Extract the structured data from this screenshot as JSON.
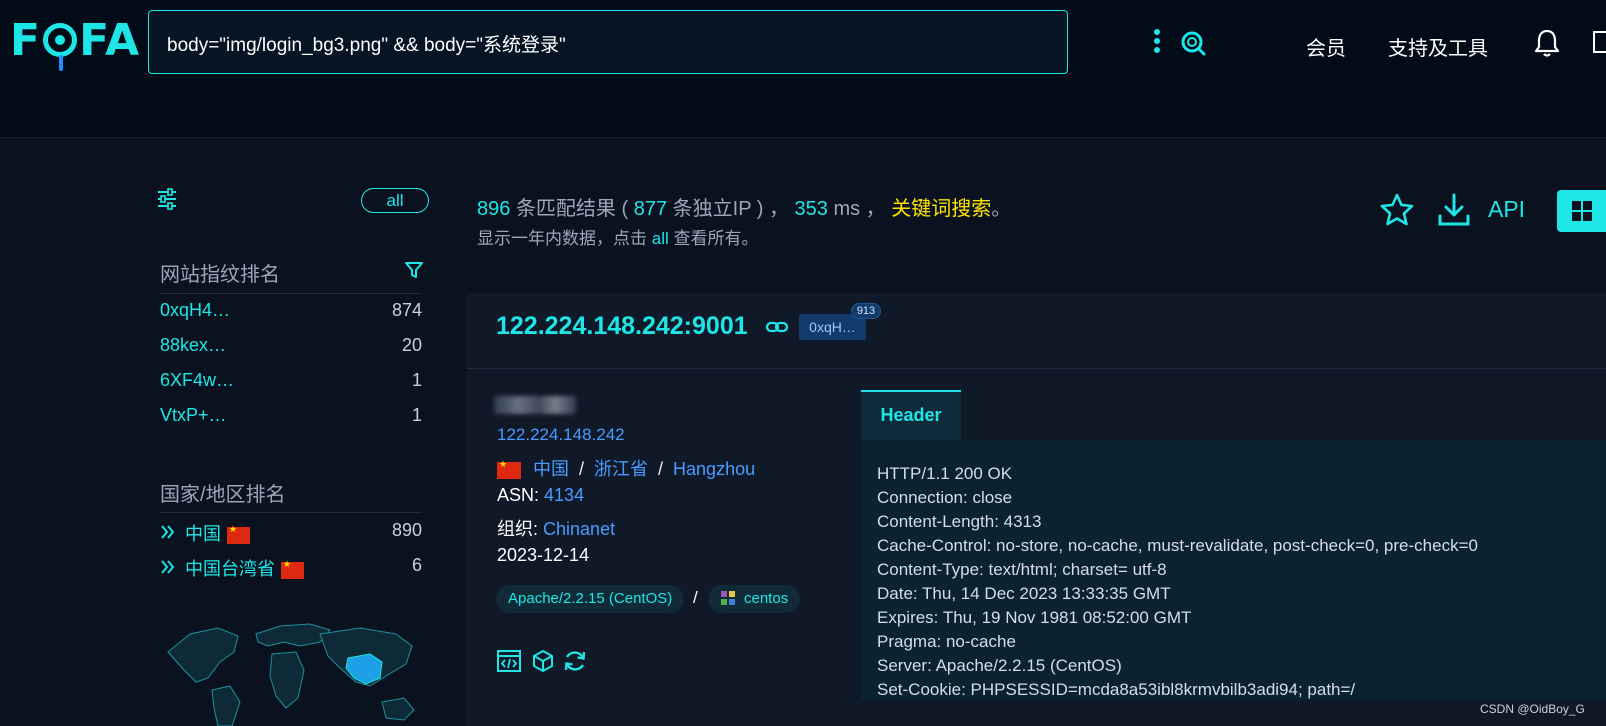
{
  "search": {
    "query": "body=\"img/login_bg3.png\" && body=\"系统登录\""
  },
  "logo": {
    "p1": "F",
    "p2": "FA"
  },
  "nav": {
    "member": "会员",
    "tools": "支持及工具"
  },
  "sidebar": {
    "all_label": "all",
    "fingerprint_title": "网站指纹排名",
    "fingerprints": [
      {
        "name": "0xqH4…",
        "count": "874"
      },
      {
        "name": "88kex…",
        "count": "20"
      },
      {
        "name": "6XF4w…",
        "count": "1"
      },
      {
        "name": "VtxP+…",
        "count": "1"
      }
    ],
    "country_title": "国家/地区排名",
    "countries": [
      {
        "name": "中国",
        "count": "890"
      },
      {
        "name": "中国台湾省",
        "count": "6"
      }
    ]
  },
  "summary": {
    "match_count": "896",
    "match_label": "条匹配结果 (",
    "ip_count": "877",
    "ip_label": "条独立IP ) ，",
    "ms": "353",
    "ms_label": "ms ，",
    "keyword": "关键词搜索",
    "end": "。",
    "note_pre": "显示一年内数据，点击",
    "note_all": "all",
    "note_post": "查看所有。"
  },
  "toolbar": {
    "api_label": "API"
  },
  "result": {
    "host": "122.224.148.242:9001",
    "tag": "0xqH…",
    "tag_count": "913",
    "ip": "122.224.148.242",
    "country": "中国",
    "province": "浙江省",
    "city": "Hangzhou",
    "sep": "/",
    "asn_label": "ASN:",
    "asn": "4134",
    "org_label": "组织:",
    "org": "Chinanet",
    "date": "2023-12-14",
    "server_chip": "Apache/2.2.15 (CentOS)",
    "os_chip": "centos",
    "tab_label": "Header",
    "header_lines": [
      "HTTP/1.1 200 OK",
      "Connection: close",
      "Content-Length: 4313",
      "Cache-Control: no-store, no-cache, must-revalidate, post-check=0, pre-check=0",
      "Content-Type: text/html; charset= utf-8",
      "Date: Thu, 14 Dec 2023 13:33:35 GMT",
      "Expires: Thu, 19 Nov 1981 08:52:00 GMT",
      "Pragma: no-cache",
      "Server: Apache/2.2.15 (CentOS)",
      "Set-Cookie: PHPSESSID=mcda8a53ibl8krmvbilb3adi94; path=/"
    ]
  },
  "watermark": "CSDN @OidBoy_G",
  "colors": {
    "accent": "#1ee6e6",
    "link": "#4a9bff",
    "keyword": "#ffe400",
    "background": "#0a1220"
  }
}
